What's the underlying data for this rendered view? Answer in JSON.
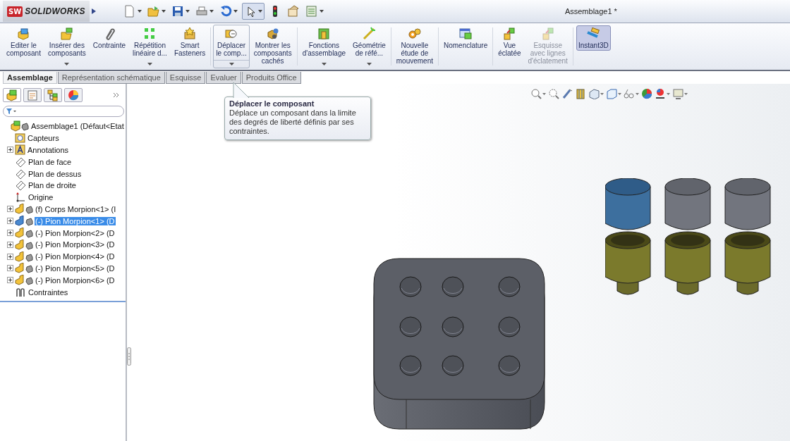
{
  "title_bar": {
    "logo_mark": "SW",
    "logo_text": "SOLIDWORKS",
    "document_title": "Assemblage1 *"
  },
  "ribbon": {
    "buttons": [
      {
        "label": "Editer le\ncomposant",
        "dropdown": false,
        "hovered": false,
        "selected": false,
        "disabled": false
      },
      {
        "label": "Insérer des\ncomposants",
        "dropdown": true,
        "hovered": false,
        "selected": false,
        "disabled": false
      },
      {
        "label": "Contrainte",
        "dropdown": false,
        "hovered": false,
        "selected": false,
        "disabled": false
      },
      {
        "label": "Répétition\nlinéaire d...",
        "dropdown": true,
        "hovered": false,
        "selected": false,
        "disabled": false
      },
      {
        "label": "Smart\nFasteners",
        "dropdown": false,
        "hovered": false,
        "selected": false,
        "disabled": false
      },
      {
        "label": "Déplacer\nle comp...",
        "dropdown": true,
        "hovered": true,
        "selected": false,
        "disabled": false
      },
      {
        "label": "Montrer les\ncomposants\ncachés",
        "dropdown": false,
        "hovered": false,
        "selected": false,
        "disabled": false
      },
      {
        "label": "Fonctions\nd'assemblage",
        "dropdown": true,
        "hovered": false,
        "selected": false,
        "disabled": false
      },
      {
        "label": "Géométrie\nde réfé...",
        "dropdown": true,
        "hovered": false,
        "selected": false,
        "disabled": false
      },
      {
        "label": "Nouvelle\nétude de\nmouvement",
        "dropdown": false,
        "hovered": false,
        "selected": false,
        "disabled": false
      },
      {
        "label": "Nomenclature",
        "dropdown": false,
        "hovered": false,
        "selected": false,
        "disabled": false
      },
      {
        "label": "Vue\néclatée",
        "dropdown": false,
        "hovered": false,
        "selected": false,
        "disabled": false
      },
      {
        "label": "Esquisse\navec lignes\nd'éclatement",
        "dropdown": false,
        "hovered": false,
        "selected": false,
        "disabled": true
      },
      {
        "label": "Instant3D",
        "dropdown": false,
        "hovered": false,
        "selected": true,
        "disabled": false
      }
    ]
  },
  "tabs": [
    {
      "label": "Assemblage",
      "selected": true
    },
    {
      "label": "Représentation schématique",
      "selected": false
    },
    {
      "label": "Esquisse",
      "selected": false
    },
    {
      "label": "Evaluer",
      "selected": false
    },
    {
      "label": "Produits Office",
      "selected": false
    }
  ],
  "tooltip": {
    "title": "Déplacer le composant",
    "text": "Déplace un composant dans la limite des degrés de liberté définis par ses contraintes."
  },
  "feature_tree": {
    "items": [
      {
        "label": "Assemblage1  (Défaut<Etat",
        "kind": "assembly",
        "expandable": false,
        "selected": false,
        "children": [
          {
            "label": "Capteurs",
            "kind": "sensor",
            "expandable": false,
            "selected": false
          },
          {
            "label": "Annotations",
            "kind": "annotation",
            "expandable": true,
            "selected": false
          },
          {
            "label": "Plan de face",
            "kind": "plane",
            "expandable": false,
            "selected": false
          },
          {
            "label": "Plan de dessus",
            "kind": "plane",
            "expandable": false,
            "selected": false
          },
          {
            "label": "Plan de droite",
            "kind": "plane",
            "expandable": false,
            "selected": false
          },
          {
            "label": "Origine",
            "kind": "origin",
            "expandable": false,
            "selected": false
          },
          {
            "label": "(f) Corps Morpion<1> (I",
            "kind": "part",
            "expandable": true,
            "selected": false
          },
          {
            "label": "(-) Pion Morpion<1> (D",
            "kind": "part",
            "expandable": true,
            "selected": true
          },
          {
            "label": "(-) Pion Morpion<2> (D",
            "kind": "part",
            "expandable": true,
            "selected": false
          },
          {
            "label": "(-) Pion Morpion<3> (D",
            "kind": "part",
            "expandable": true,
            "selected": false
          },
          {
            "label": "(-) Pion Morpion<4> (D",
            "kind": "part",
            "expandable": true,
            "selected": false
          },
          {
            "label": "(-) Pion Morpion<5> (D",
            "kind": "part",
            "expandable": true,
            "selected": false
          },
          {
            "label": "(-) Pion Morpion<6> (D",
            "kind": "part",
            "expandable": true,
            "selected": false
          },
          {
            "label": "Contraintes",
            "kind": "mates",
            "expandable": false,
            "selected": false
          }
        ]
      }
    ]
  }
}
